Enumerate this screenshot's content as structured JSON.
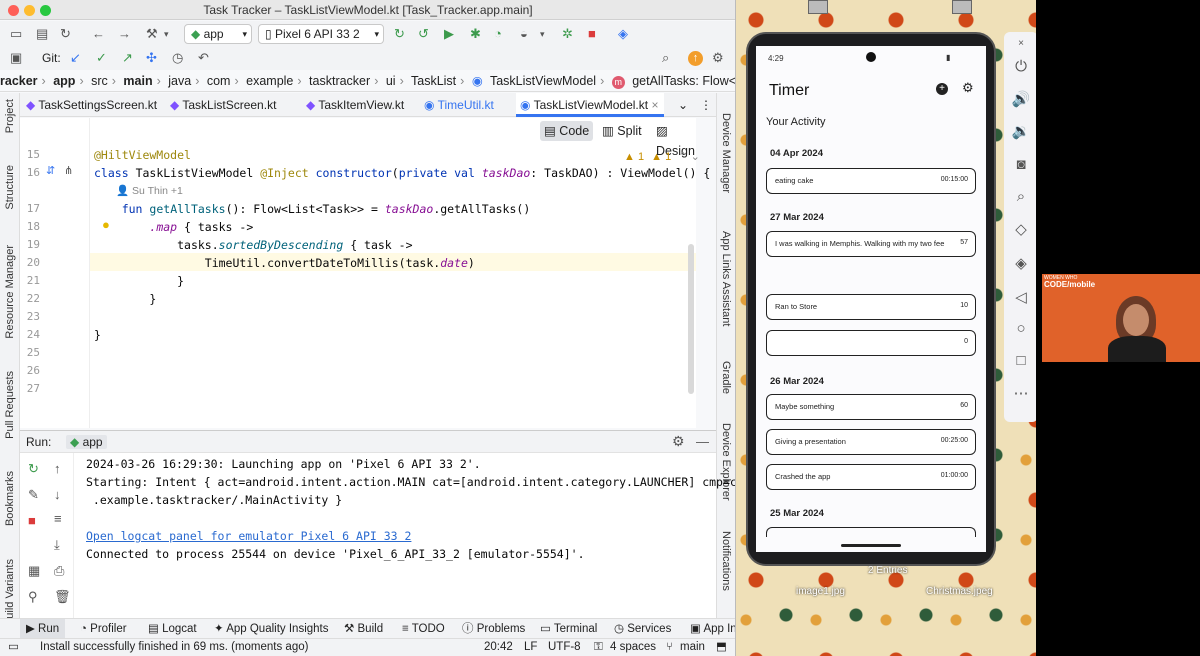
{
  "window": {
    "title": "Task Tracker – TaskListViewModel.kt [Task_Tracker.app.main]"
  },
  "toolbar": {
    "run_config": "app",
    "device": "Pixel 6 API 33 2",
    "git_label": "Git:"
  },
  "breadcrumb": [
    "racker",
    "app",
    "src",
    "main",
    "java",
    "com",
    "example",
    "tasktracker",
    "ui",
    "TaskList",
    "TaskListViewModel",
    "getAllTasks: Flow<List<Task>>"
  ],
  "tabs": [
    {
      "label": "TaskSettingsScreen.kt"
    },
    {
      "label": "TaskListScreen.kt"
    },
    {
      "label": "TaskItemView.kt"
    },
    {
      "label": "TimeUtil.kt"
    },
    {
      "label": "TaskListViewModel.kt"
    }
  ],
  "view_toggle": {
    "code": "Code",
    "split": "Split",
    "design": "Design"
  },
  "inspections": {
    "warnings": "1",
    "weak": "1"
  },
  "code": {
    "line_numbers": [
      "15",
      "16",
      "",
      "17",
      "18",
      "19",
      "20",
      "21",
      "22",
      "23",
      "24",
      "25",
      "26",
      "27"
    ],
    "annotation": "@HiltViewModel",
    "author": "Su Thin +1",
    "l16_kw": "class",
    "l16_name": "TaskListViewModel",
    "l16_inject": "@Inject",
    "l16_ctor": "constructor",
    "l16_rest1": "(",
    "l16_private": "private val",
    "l16_param": "taskDao",
    "l16_rest2": ": TaskDAO) : ViewModel() {",
    "l17_fun": "fun",
    "l17_name": "getAllTasks",
    "l17_rest": "(): Flow<List<Task>> = ",
    "l17_field": "taskDao",
    "l17_call": ".getAllTasks()",
    "l18_map": ".map",
    "l18_rest": " { tasks ->",
    "l19_pre": "tasks.",
    "l19_fn": "sortedByDescending",
    "l19_rest": " { task ->",
    "l20_pre": "TimeUtil.",
    "l20_fn": "convertDateToMillis",
    "l20_rest1": "(task.",
    "l20_field": "date",
    "l20_rest2": ")",
    "l21": "}",
    "l22": "}",
    "l24": "}"
  },
  "run_panel": {
    "label": "Run:",
    "config": "app",
    "lines": [
      "2024-03-26 16:29:30: Launching app on 'Pixel 6 API 33 2'.",
      "Starting: Intent { act=android.intent.action.MAIN cat=[android.intent.category.LAUNCHER] cmp=com",
      " .example.tasktracker/.MainActivity }",
      "",
      "Open logcat panel for emulator Pixel 6 API 33 2",
      "Connected to process 25544 on device 'Pixel_6_API_33_2 [emulator-5554]'."
    ]
  },
  "left_tools": [
    "Project",
    "Structure",
    "Resource Manager",
    "Pull Requests",
    "Bookmarks",
    "Build Variants"
  ],
  "right_tools": [
    "Device Manager",
    "App Links Assistant",
    "Gradle",
    "Device Explorer",
    "Notifications"
  ],
  "bottom_tabs": [
    "Run",
    "Profiler",
    "Logcat",
    "App Quality Insights",
    "Build",
    "TODO",
    "Problems",
    "Terminal",
    "Services",
    "App Ins"
  ],
  "status": {
    "message": "Install successfully finished in 69 ms. (moments ago)",
    "position": "20:42",
    "line_sep": "LF",
    "encoding": "UTF-8",
    "indent": "4 spaces",
    "branch": "main"
  },
  "phone": {
    "time": "4:29",
    "app_title": "Timer",
    "section": "Your Activity",
    "groups": [
      {
        "date": "04 Apr 2024",
        "items": [
          {
            "name": "eating cake",
            "value": "00:15:00"
          }
        ]
      },
      {
        "date": "27 Mar 2024",
        "items": [
          {
            "name": "I was walking in Memphis. Walking with my two fee...",
            "value": "57"
          },
          {
            "name": "Ran to Store",
            "value": "10"
          },
          {
            "name": "",
            "value": "0"
          }
        ]
      },
      {
        "date": "26 Mar 2024",
        "items": [
          {
            "name": "Maybe something",
            "value": "60"
          },
          {
            "name": "Giving a presentation",
            "value": "00:25:00"
          },
          {
            "name": "Crashed the app",
            "value": "01:00:00"
          }
        ]
      },
      {
        "date": "25 Mar 2024",
        "items": []
      }
    ]
  },
  "desktop": {
    "entries": "2 Entries",
    "file1": "image1.jpg",
    "file2": "Christmas.jpeg"
  },
  "webcam": {
    "brand": "CODE/mobile",
    "small": "WOMEN WHO"
  }
}
